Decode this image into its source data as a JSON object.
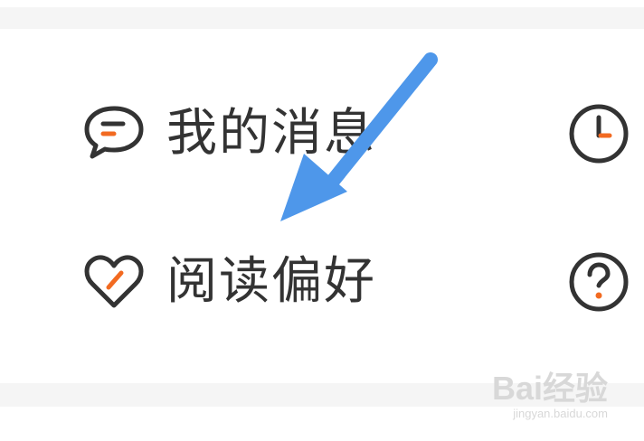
{
  "menu": {
    "items": [
      {
        "label": "我的消息",
        "icon": "chat-bubble-icon"
      },
      {
        "label": "阅读偏好",
        "icon": "heart-icon"
      }
    ],
    "side_icons": [
      "clock-icon",
      "help-icon"
    ]
  },
  "watermark": {
    "brand": "Bai经验",
    "url": "jingyan.baidu.com"
  },
  "colors": {
    "text": "#333333",
    "accent": "#f26a21",
    "arrow": "#4e97ea",
    "band": "#f5f5f5"
  }
}
